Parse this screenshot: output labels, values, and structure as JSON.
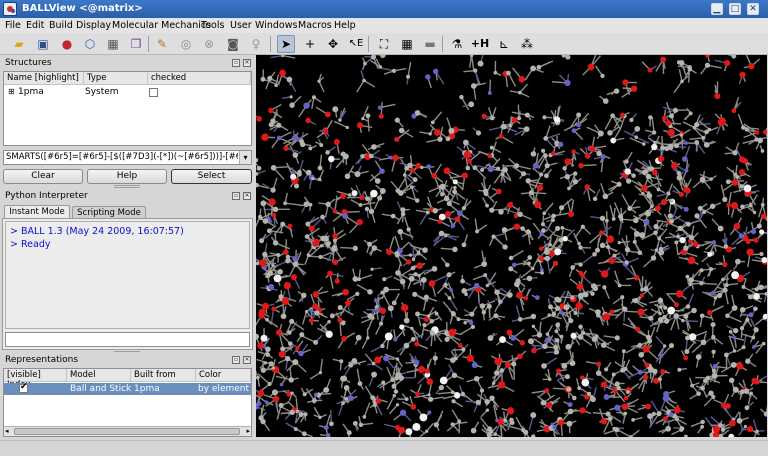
{
  "window": {
    "title": "BALLView <@matrix>",
    "controls": [
      "minimize",
      "maximize",
      "close"
    ]
  },
  "menubar": [
    "File",
    "Edit",
    "Build",
    "Display",
    "Molecular Mechanics",
    "Tools",
    "User",
    "Windows",
    "Macros",
    "Help"
  ],
  "toolbar": {
    "icons": [
      "open-folder-icon",
      "save-icon",
      "atoms-icon",
      "hexagon-icon",
      "structure-edit-icon",
      "copy-icon",
      "paint-icon",
      "target-icon",
      "stop-icon",
      "screenshot-icon",
      "bulb-icon",
      "select-cursor-icon",
      "crosshair-icon",
      "move-icon",
      "edit-mode-icon",
      "fit-view-icon",
      "grid-icon",
      "camera-icon",
      "flask-icon",
      "add-hydrogens-icon",
      "plot-icon",
      "network-icon"
    ]
  },
  "structures": {
    "title": "Structures",
    "columns": [
      "Name [highlight]",
      "Type",
      "checked"
    ],
    "rows": [
      {
        "name": "1pma",
        "type": "System",
        "checked": false
      }
    ]
  },
  "selector": {
    "smarts_value": "SMARTS([#6r5]=[#6r5]-[$([#7D3](-[*])(~[#6r5]))]-[#6r5])",
    "clear_label": "Clear",
    "help_label": "Help",
    "select_label": "Select"
  },
  "python": {
    "title": "Python Interpreter",
    "tabs": [
      "Instant Mode",
      "Scripting Mode"
    ],
    "active_tab": "Instant Mode",
    "output": [
      "> BALL 1.3 (May 24 2009, 16:07:57)",
      "> Ready"
    ],
    "input_value": ""
  },
  "representations": {
    "title": "Representations",
    "columns": [
      "[visible] Index",
      "Model",
      "Built from",
      "Color"
    ],
    "rows": [
      {
        "visible": true,
        "model": "Ball and Stick",
        "built_from": "1pma",
        "color": "by element"
      }
    ]
  },
  "colors": {
    "titlebar": "#2f67b4",
    "selection_row": "#6a8fbc",
    "python_text": "#0a12c8",
    "viewer_background": "#000000",
    "carbon": "#b4b4ae",
    "oxygen": "#e01818",
    "nitrogen": "#6464c8",
    "hydrogen": "#f2f2f2"
  }
}
